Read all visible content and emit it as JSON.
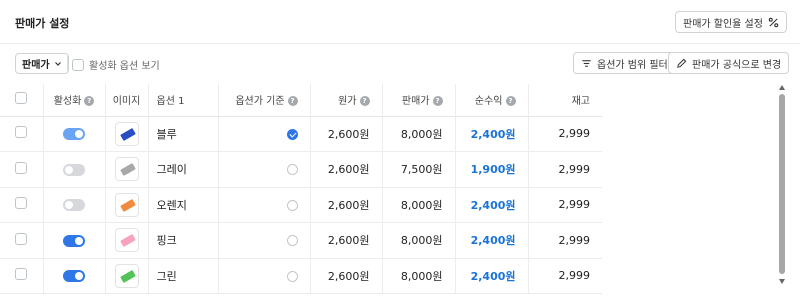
{
  "header": {
    "title": "판매가 설정",
    "discount_button": "판매가 할인율 설정"
  },
  "toolbar": {
    "select_label": "판매가",
    "option_toggle_label": "활성화 옵션 보기",
    "range_filter_button": "옵션가 범위 필터",
    "formula_button": "판매가 공식으로 변경"
  },
  "table": {
    "headers": {
      "active": "활성화",
      "image": "이미지",
      "option1": "옵션 1",
      "base_option": "옵션가 기준",
      "cost": "원가",
      "price": "판매가",
      "profit": "순수익",
      "stock": "재고"
    },
    "rows": [
      {
        "active": true,
        "soft": true,
        "option": "블루",
        "base": true,
        "cost": "2,600원",
        "price": "8,000원",
        "profit": "2,400원",
        "stock": "2,999",
        "color": "#2a4fc4"
      },
      {
        "active": false,
        "soft": false,
        "option": "그레이",
        "base": false,
        "cost": "2,600원",
        "price": "7,500원",
        "profit": "1,900원",
        "stock": "2,999",
        "color": "#a8a8a8"
      },
      {
        "active": false,
        "soft": false,
        "option": "오렌지",
        "base": false,
        "cost": "2,600원",
        "price": "8,000원",
        "profit": "2,400원",
        "stock": "2,999",
        "color": "#f08a3c"
      },
      {
        "active": true,
        "soft": false,
        "option": "핑크",
        "base": false,
        "cost": "2,600원",
        "price": "8,000원",
        "profit": "2,400원",
        "stock": "2,999",
        "color": "#f5a3c0"
      },
      {
        "active": true,
        "soft": false,
        "option": "그린",
        "base": false,
        "cost": "2,600원",
        "price": "8,000원",
        "profit": "2,400원",
        "stock": "2,999",
        "color": "#52c45a"
      }
    ]
  },
  "icons": {
    "help": "question-circle-icon",
    "percent": "percent-icon",
    "filter": "filter-icon",
    "edit": "pencil-icon",
    "chevron": "chevron-down-icon"
  },
  "colors": {
    "accent": "#2f76e6",
    "profit": "#1a73d6"
  }
}
